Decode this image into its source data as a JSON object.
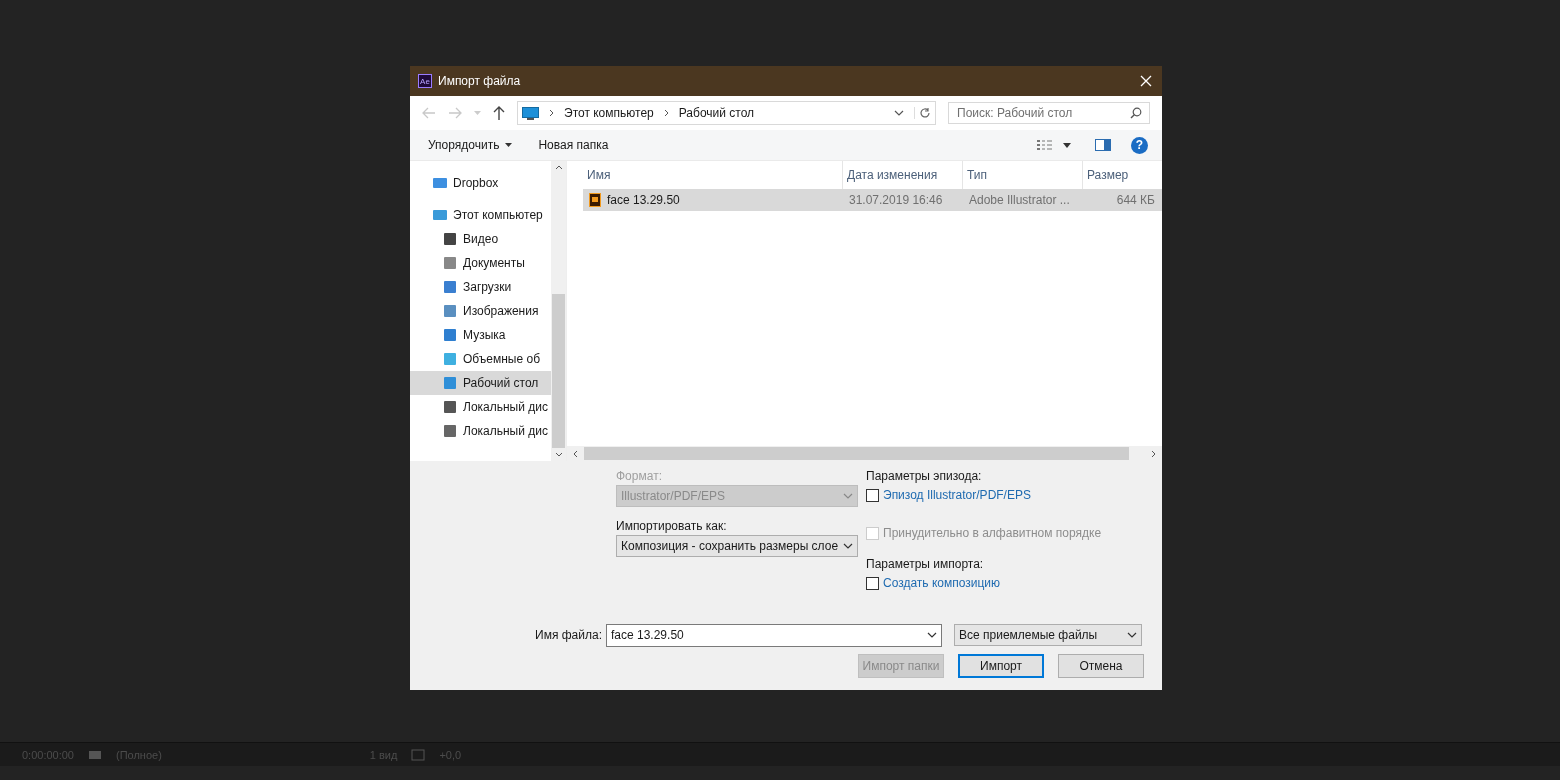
{
  "window": {
    "title": "Импорт файла",
    "app_badge": "Ae"
  },
  "address": {
    "path": [
      "Этот компьютер",
      "Рабочий стол"
    ],
    "search_placeholder": "Поиск: Рабочий стол"
  },
  "toolbar": {
    "organize": "Упорядочить",
    "new_folder": "Новая папка",
    "help": "?"
  },
  "sidebar": {
    "items": [
      {
        "label": "Dropbox",
        "kind": "dropbox",
        "selected": false
      },
      {
        "label": "Этот компьютер",
        "kind": "computer",
        "selected": false,
        "children": [
          {
            "label": "Видео",
            "kind": "video",
            "selected": false
          },
          {
            "label": "Документы",
            "kind": "documents",
            "selected": false
          },
          {
            "label": "Загрузки",
            "kind": "downloads",
            "selected": false
          },
          {
            "label": "Изображения",
            "kind": "pictures",
            "selected": false
          },
          {
            "label": "Музыка",
            "kind": "music",
            "selected": false
          },
          {
            "label": "Объемные об",
            "kind": "objects",
            "selected": false
          },
          {
            "label": "Рабочий стол",
            "kind": "desktop",
            "selected": true
          },
          {
            "label": "Локальный дис",
            "kind": "disk-windows",
            "selected": false
          },
          {
            "label": "Локальный дис",
            "kind": "disk",
            "selected": false
          }
        ]
      }
    ]
  },
  "table": {
    "columns": [
      "Имя",
      "Дата изменения",
      "Тип",
      "Размер"
    ],
    "rows": [
      {
        "name": "face 13.29.50",
        "date": "31.07.2019 16:46",
        "type": "Adobe Illustrator ...",
        "size": "644 КБ",
        "selected": true
      }
    ]
  },
  "options": {
    "format_label": "Формат:",
    "format_value": "Illustrator/PDF/EPS",
    "format_disabled": true,
    "import_as_label": "Импортировать как:",
    "import_as_value": "Композиция - сохранить размеры слое",
    "groups": [
      {
        "heading": "Параметры эпизода:",
        "checkboxes": [
          {
            "label": "Эпизод Illustrator/PDF/EPS",
            "checked": false,
            "disabled": false
          },
          {
            "label": "Принудительно в алфавитном порядке",
            "checked": false,
            "disabled": true
          }
        ]
      },
      {
        "heading": "Параметры импорта:",
        "checkboxes": [
          {
            "label": "Создать композицию",
            "checked": false,
            "disabled": false
          }
        ]
      }
    ]
  },
  "filename": {
    "label": "Имя файла:",
    "value": "face 13.29.50"
  },
  "filter": "Все приемлемые файлы",
  "buttons": [
    {
      "label": "Импорт папки",
      "disabled": true,
      "default": false
    },
    {
      "label": "Импорт",
      "disabled": false,
      "default": true
    },
    {
      "label": "Отмена",
      "disabled": false,
      "default": false
    }
  ],
  "background_bar": {
    "timecode": "0:00:00:00",
    "resolution": "(Полное)",
    "views": "1 вид",
    "exposure": "+0,0"
  }
}
